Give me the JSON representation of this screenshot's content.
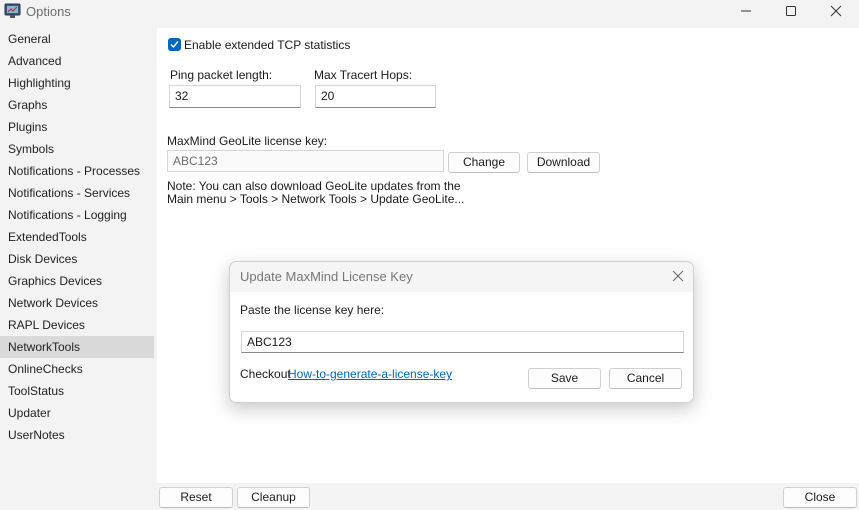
{
  "window": {
    "title": "Options"
  },
  "sidebar": {
    "items": [
      {
        "label": "General"
      },
      {
        "label": "Advanced"
      },
      {
        "label": "Highlighting"
      },
      {
        "label": "Graphs"
      },
      {
        "label": "Plugins"
      },
      {
        "label": "Symbols"
      },
      {
        "label": "Notifications - Processes"
      },
      {
        "label": "Notifications - Services"
      },
      {
        "label": "Notifications - Logging"
      },
      {
        "label": "ExtendedTools"
      },
      {
        "label": "Disk Devices"
      },
      {
        "label": "Graphics Devices"
      },
      {
        "label": "Network Devices"
      },
      {
        "label": "RAPL Devices"
      },
      {
        "label": "NetworkTools",
        "selected": true
      },
      {
        "label": "OnlineChecks"
      },
      {
        "label": "ToolStatus"
      },
      {
        "label": "Updater"
      },
      {
        "label": "UserNotes"
      }
    ]
  },
  "main": {
    "tcp_stats_label": "Enable extended TCP statistics",
    "tcp_stats_checked": true,
    "ping_label": "Ping packet length:",
    "ping_value": "32",
    "hops_label": "Max Tracert Hops:",
    "hops_value": "20",
    "geolite_label": "MaxMind GeoLite license key:",
    "geolite_value": "ABC123",
    "change_label": "Change",
    "download_label": "Download",
    "note_line1": "Note: You can also download GeoLite updates from the",
    "note_line2": "Main menu > Tools > Network Tools > Update GeoLite..."
  },
  "footer": {
    "reset_label": "Reset",
    "cleanup_label": "Cleanup",
    "close_label": "Close"
  },
  "dialog": {
    "title": "Update MaxMind License Key",
    "prompt": "Paste the license key here:",
    "key_value": "ABC123",
    "checkout_text": "Checkout",
    "link_text": "How-to-generate-a-license-key",
    "save_label": "Save",
    "cancel_label": "Cancel"
  },
  "colors": {
    "accent": "#0067c0",
    "selected_bg": "#dadada",
    "window_bg": "#f3f3f3"
  }
}
